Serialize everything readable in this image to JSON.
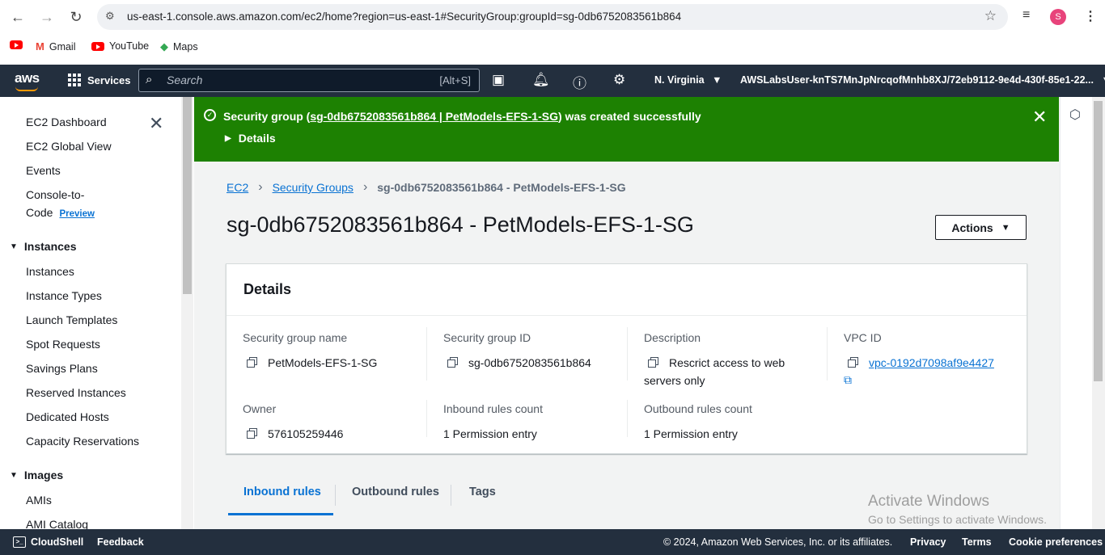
{
  "browser": {
    "url": "us-east-1.console.aws.amazon.com/ec2/home?region=us-east-1#SecurityGroup:groupId=sg-0db6752083561b864",
    "profile_initial": "S",
    "bookmarks": [
      {
        "label": "Gmail"
      },
      {
        "label": "YouTube"
      },
      {
        "label": "Maps"
      }
    ]
  },
  "topnav": {
    "logo": "aws",
    "services_label": "Services",
    "search_placeholder": "Search",
    "search_shortcut": "[Alt+S]",
    "region": "N. Virginia",
    "account": "AWSLabsUser-knTS7MnJpNrcqofMnhb8XJ/72eb9112-9e4d-430f-85e1-22..."
  },
  "sidebar": {
    "items": [
      {
        "label": "EC2 Dashboard"
      },
      {
        "label": "EC2 Global View"
      },
      {
        "label": "Events"
      },
      {
        "label": "Console-to-"
      },
      {
        "label": "Code"
      }
    ],
    "preview_badge": "Preview",
    "sections": [
      {
        "title": "Instances",
        "items": [
          "Instances",
          "Instance Types",
          "Launch Templates",
          "Spot Requests",
          "Savings Plans",
          "Reserved Instances",
          "Dedicated Hosts",
          "Capacity Reservations"
        ]
      },
      {
        "title": "Images",
        "items": [
          "AMIs",
          "AMI Catalog"
        ]
      }
    ]
  },
  "flash": {
    "prefix": "Security group (",
    "link": "sg-0db6752083561b864 | PetModels-EFS-1-SG",
    "suffix": ") was created successfully",
    "details_label": "Details",
    "color": "#1d8102"
  },
  "breadcrumb": {
    "items": [
      "EC2",
      "Security Groups"
    ],
    "current": "sg-0db6752083561b864 - PetModels-EFS-1-SG"
  },
  "page": {
    "title": "sg-0db6752083561b864 - PetModels-EFS-1-SG",
    "actions_label": "Actions"
  },
  "details": {
    "heading": "Details",
    "fields": {
      "sg_name": {
        "label": "Security group name",
        "value": "PetModels-EFS-1-SG"
      },
      "sg_id": {
        "label": "Security group ID",
        "value": "sg-0db6752083561b864"
      },
      "description": {
        "label": "Description",
        "value": "Rescrict access to web servers only"
      },
      "vpc_id": {
        "label": "VPC ID",
        "value": "vpc-0192d7098af9e4427"
      },
      "owner": {
        "label": "Owner",
        "value": "576105259446"
      },
      "inbound_count": {
        "label": "Inbound rules count",
        "value": "1 Permission entry"
      },
      "outbound_count": {
        "label": "Outbound rules count",
        "value": "1 Permission entry"
      }
    }
  },
  "tabs": [
    {
      "label": "Inbound rules",
      "active": true
    },
    {
      "label": "Outbound rules",
      "active": false
    },
    {
      "label": "Tags",
      "active": false
    }
  ],
  "watermark": {
    "line1": "Activate Windows",
    "line2": "Go to Settings to activate Windows."
  },
  "footer": {
    "cloudshell": "CloudShell",
    "feedback": "Feedback",
    "copyright": "© 2024, Amazon Web Services, Inc. or its affiliates.",
    "privacy": "Privacy",
    "terms": "Terms",
    "cookies": "Cookie preferences"
  },
  "colors": {
    "accent": "#0972d3",
    "nav_bg": "#232f3e",
    "success": "#1d8102"
  }
}
